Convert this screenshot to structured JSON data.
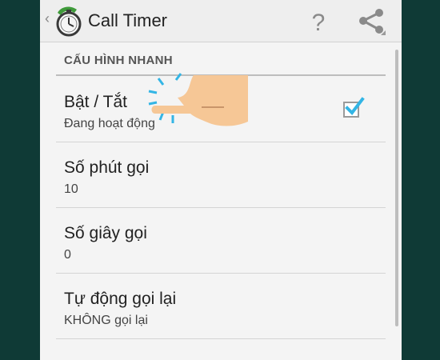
{
  "actionbar": {
    "title": "Call Timer",
    "icons": {
      "up": "chevron-left-icon",
      "app": "stopwatch-phone-icon",
      "help": "help-icon",
      "share": "share-icon"
    }
  },
  "section": {
    "header": "CẤU HÌNH NHANH"
  },
  "prefs": [
    {
      "title": "Bật / Tắt",
      "summary": "Đang hoạt động",
      "checked": true
    },
    {
      "title": "Số phút gọi",
      "summary": "10"
    },
    {
      "title": "Số giây gọi",
      "summary": "0"
    },
    {
      "title": "Tự động gọi lại",
      "summary": "KHÔNG gọi lại"
    }
  ],
  "colors": {
    "accent": "#33b5e5",
    "app_icon_green": "#3f9b3a",
    "background": "#0f3a36"
  }
}
